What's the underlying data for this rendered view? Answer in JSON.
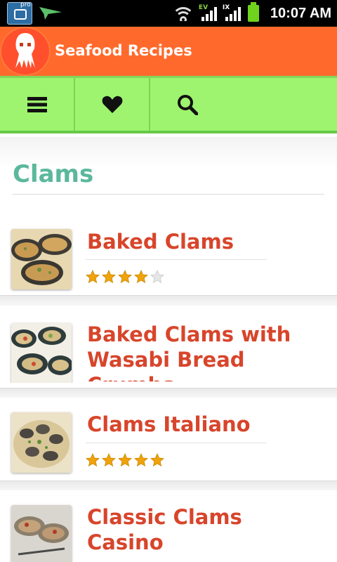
{
  "status_bar": {
    "time": "10:07 AM",
    "camera_badge": "pro",
    "signal_1_label": "EV",
    "signal_2_label": "IX"
  },
  "app": {
    "title": "Seafood Recipes"
  },
  "toolbar": {
    "items": [
      {
        "icon": "menu-icon"
      },
      {
        "icon": "heart-icon"
      },
      {
        "icon": "search-icon"
      }
    ]
  },
  "section": {
    "title": "Clams"
  },
  "recipes": [
    {
      "title": "Baked Clams",
      "rating": 4
    },
    {
      "title": "Baked Clams with Wasabi Bread Crumbs",
      "rating": null
    },
    {
      "title": "Clams Italiano",
      "rating": 5
    },
    {
      "title": "Classic Clams Casino",
      "rating": null
    }
  ],
  "colors": {
    "title_bar": "#ff6a2c",
    "toolbar": "#9ef46e",
    "section_title": "#5bb89c",
    "recipe_title": "#d8452b",
    "star": "#f0a30a"
  }
}
